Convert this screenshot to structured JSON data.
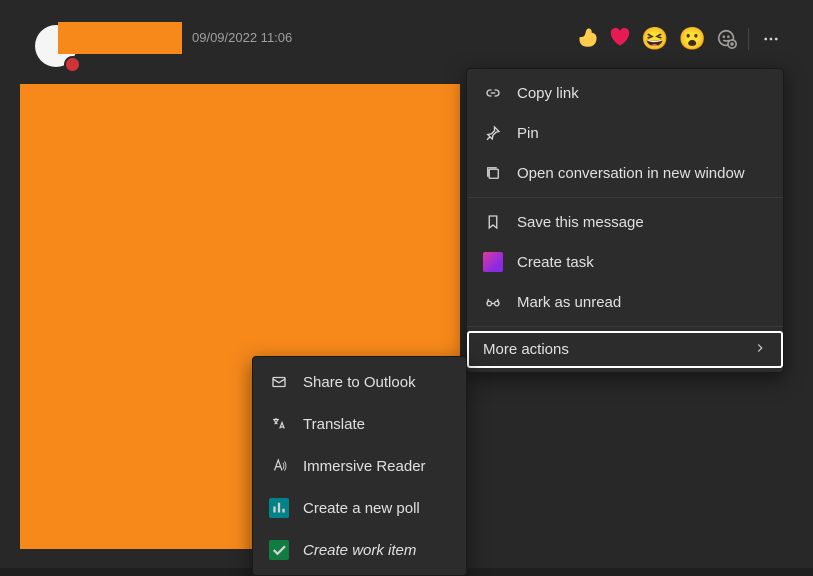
{
  "message": {
    "timestamp": "09/09/2022 11:06"
  },
  "reactions": {
    "laugh": "😆",
    "surprised": "😮"
  },
  "context_menu": {
    "copy_link": "Copy link",
    "pin": "Pin",
    "open_window": "Open conversation in new window",
    "save": "Save this message",
    "create_task": "Create task",
    "unread": "Mark as unread",
    "more_actions": "More actions"
  },
  "submenu": {
    "share_outlook": "Share to Outlook",
    "translate": "Translate",
    "immersive": "Immersive Reader",
    "new_poll": "Create a new poll",
    "work_item": "Create work item"
  }
}
